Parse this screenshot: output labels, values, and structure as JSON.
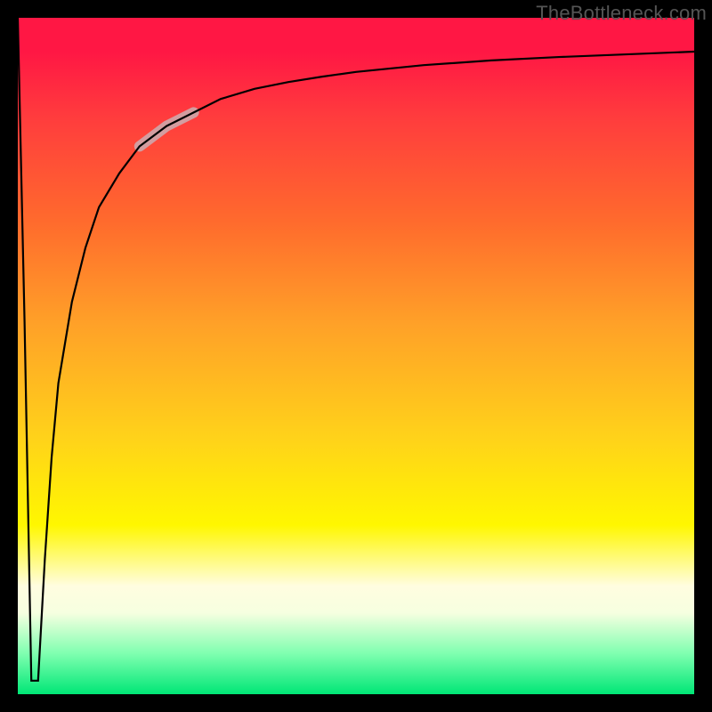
{
  "watermark": "TheBottleneck.com",
  "chart_data": {
    "type": "line",
    "title": "",
    "xlabel": "",
    "ylabel": "",
    "x_range": [
      0,
      100
    ],
    "y_range": [
      0,
      100
    ],
    "grid": false,
    "legend": null,
    "background_gradient": {
      "direction": "vertical",
      "stops": [
        {
          "pos": 0.0,
          "color": "#ff1744"
        },
        {
          "pos": 0.3,
          "color": "#ff6a2d"
        },
        {
          "pos": 0.62,
          "color": "#ffd21a"
        },
        {
          "pos": 0.84,
          "color": "#fffde0"
        },
        {
          "pos": 1.0,
          "color": "#00e676"
        }
      ]
    },
    "series": [
      {
        "name": "curve",
        "color": "#000000",
        "width": 2,
        "x": [
          0,
          1,
          2,
          3,
          4,
          5,
          6,
          8,
          10,
          12,
          15,
          18,
          22,
          26,
          30,
          35,
          40,
          45,
          50,
          60,
          70,
          80,
          90,
          100
        ],
        "y": [
          100,
          55,
          2,
          2,
          20,
          35,
          46,
          58,
          66,
          72,
          77,
          81,
          84,
          86,
          88,
          89.5,
          90.5,
          91.3,
          92,
          93,
          93.7,
          94.2,
          94.6,
          95
        ]
      },
      {
        "name": "highlight-segment",
        "color": "#d39da0",
        "width": 10,
        "x": [
          18,
          22,
          26
        ],
        "y": [
          81,
          84,
          86
        ]
      }
    ],
    "annotations": []
  }
}
